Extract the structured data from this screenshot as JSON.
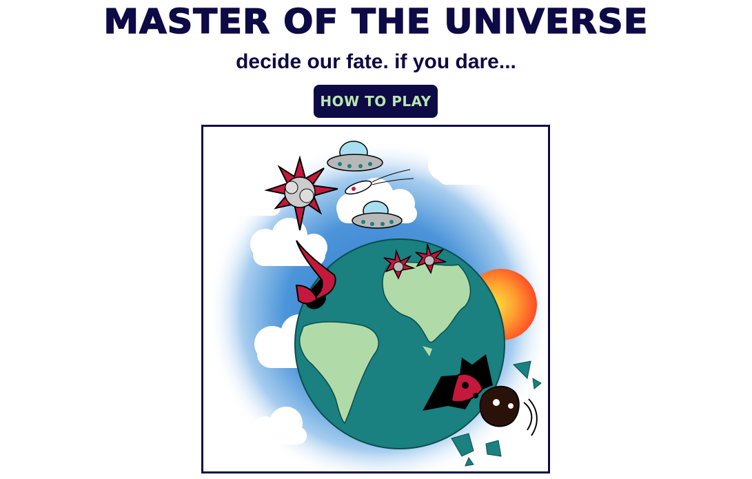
{
  "header": {
    "title": "MASTER OF THE UNIVERSE",
    "subtitle": "decide our fate. if you dare..."
  },
  "controls": {
    "how_to_play_label": "HOW TO PLAY"
  },
  "colors": {
    "navy": "#0d0a45",
    "button_text": "#b8e6b0",
    "ocean": "#1a8080",
    "land": "#b0dba8",
    "sky": "#3d87d4",
    "sun": "#ff5a2a",
    "alien_red": "#c4183c"
  }
}
